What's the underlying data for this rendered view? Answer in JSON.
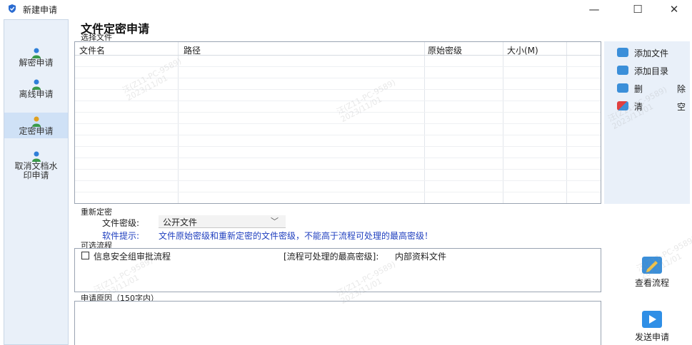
{
  "window": {
    "title": "新建申请",
    "minimize_glyph": "—",
    "maximize_glyph": "☐",
    "close_glyph": "✕"
  },
  "sidebar": {
    "items": [
      {
        "label": "解密申请",
        "icon": "user-icon",
        "active": false
      },
      {
        "label": "离线申请",
        "icon": "user-icon",
        "active": false
      },
      {
        "label": "定密申请",
        "icon": "user-icon",
        "active": true
      },
      {
        "label_line1": "取消文档水",
        "label_line2": "印申请",
        "icon": "user-icon",
        "active": false
      }
    ]
  },
  "main": {
    "title": "文件定密申请",
    "select_files_label": "选择文件",
    "table": {
      "columns": [
        "文件名",
        "路径",
        "原始密级",
        "大小(M)"
      ],
      "rows": []
    },
    "actions": {
      "add_file": "添加文件",
      "add_dir": "添加目录",
      "delete_a": "删",
      "delete_b": "除",
      "clear_a": "清",
      "clear_b": "空"
    },
    "reclassify": {
      "section_label": "重新定密",
      "level_label": "文件密级:",
      "level_value": "公开文件",
      "hint_label": "软件提示:",
      "hint_text": "文件原始密级和重新定密的文件密级，不能高于流程可处理的最高密级！"
    },
    "flows": {
      "section_label": "可选流程",
      "items": [
        {
          "name": "信息安全组审批流程",
          "max_level_label": "[流程可处理的最高密级]:",
          "max_level_value": "内部资料文件",
          "checked": false
        }
      ],
      "view_button": "查看流程"
    },
    "reason": {
      "label": "申请原因（150字内）",
      "value": "",
      "send_button": "发送申请"
    }
  },
  "watermark": {
    "line1": "汪(Z11-PC-9589)",
    "line2": "2023/11/01"
  },
  "colors": {
    "sidebar_bg": "#e9f0f9",
    "sidebar_active": "#cfe1f6",
    "hint_blue": "#1f3fbf",
    "border": "#9aa4b2"
  }
}
